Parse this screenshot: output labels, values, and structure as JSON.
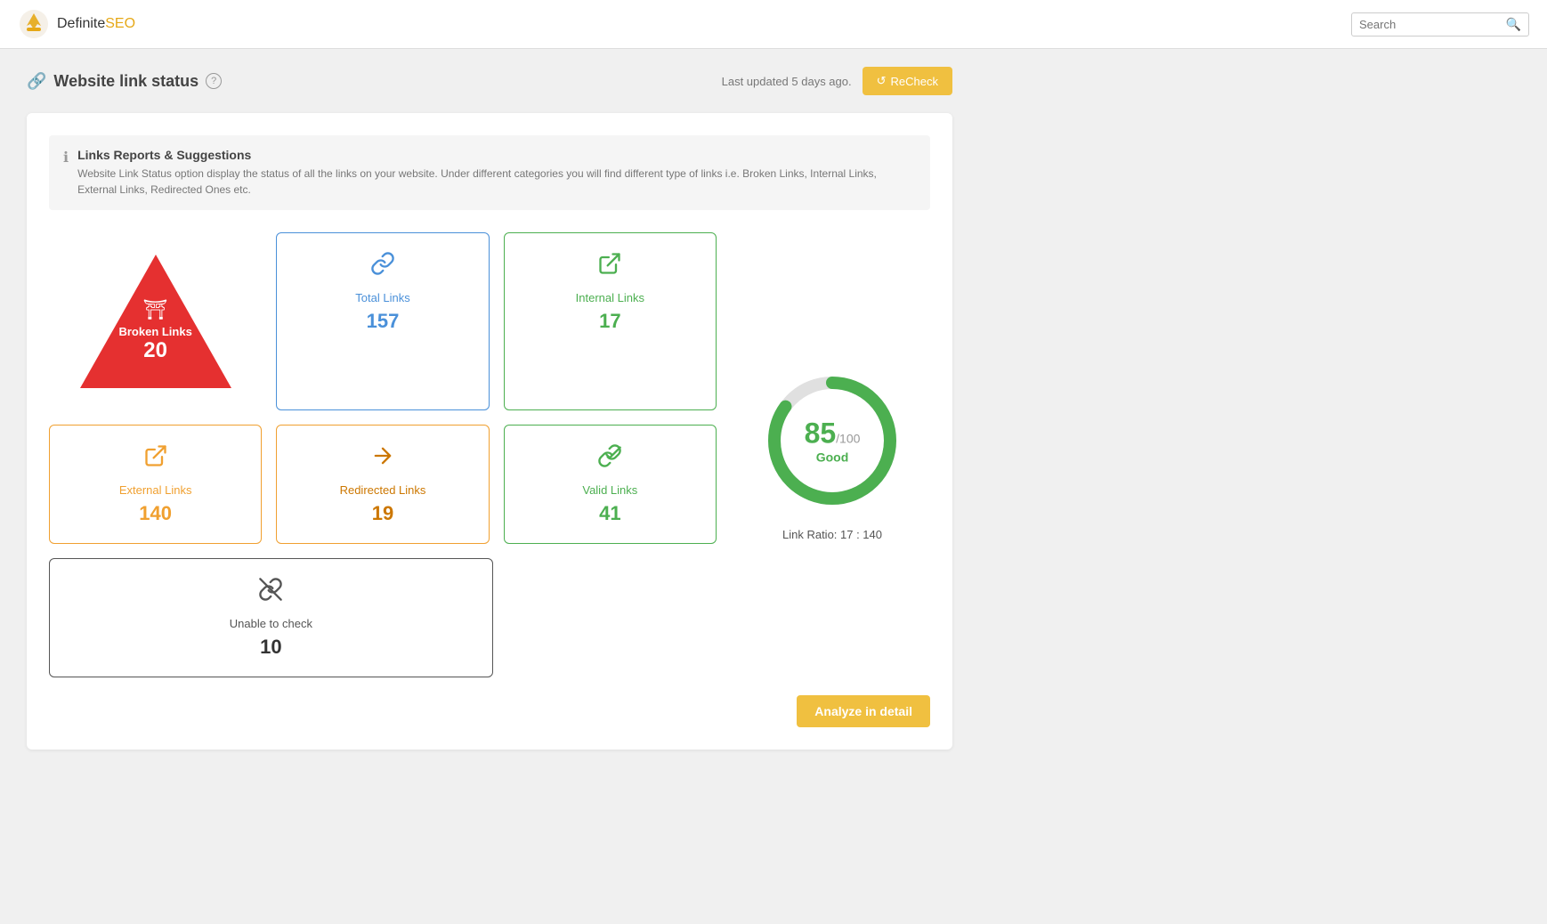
{
  "header": {
    "logo_definite": "Definite",
    "logo_seo": "SEO",
    "search_placeholder": "Search"
  },
  "page": {
    "title": "Website link status",
    "last_updated": "Last updated 5 days ago.",
    "recheck_label": "ReCheck"
  },
  "info_banner": {
    "title": "Links Reports & Suggestions",
    "description": "Website Link Status option display the status of all the links on your website. Under different categories you will find different type of links i.e. Broken Links, Internal Links, External Links, Redirected Ones etc."
  },
  "stats": {
    "broken_links": {
      "label": "Broken Links",
      "value": "20"
    },
    "total_links": {
      "label": "Total Links",
      "value": "157"
    },
    "internal_links": {
      "label": "Internal Links",
      "value": "17"
    },
    "external_links": {
      "label": "External Links",
      "value": "140"
    },
    "redirected_links": {
      "label": "Redirected Links",
      "value": "19"
    },
    "valid_links": {
      "label": "Valid Links",
      "value": "41"
    },
    "unable_to_check": {
      "label": "Unable to check",
      "value": "10"
    }
  },
  "score": {
    "value": "85",
    "max": "100",
    "label": "Good",
    "ratio_label": "Link Ratio: 17 : 140",
    "percentage": 85
  },
  "analyze_button": "Analyze in detail"
}
